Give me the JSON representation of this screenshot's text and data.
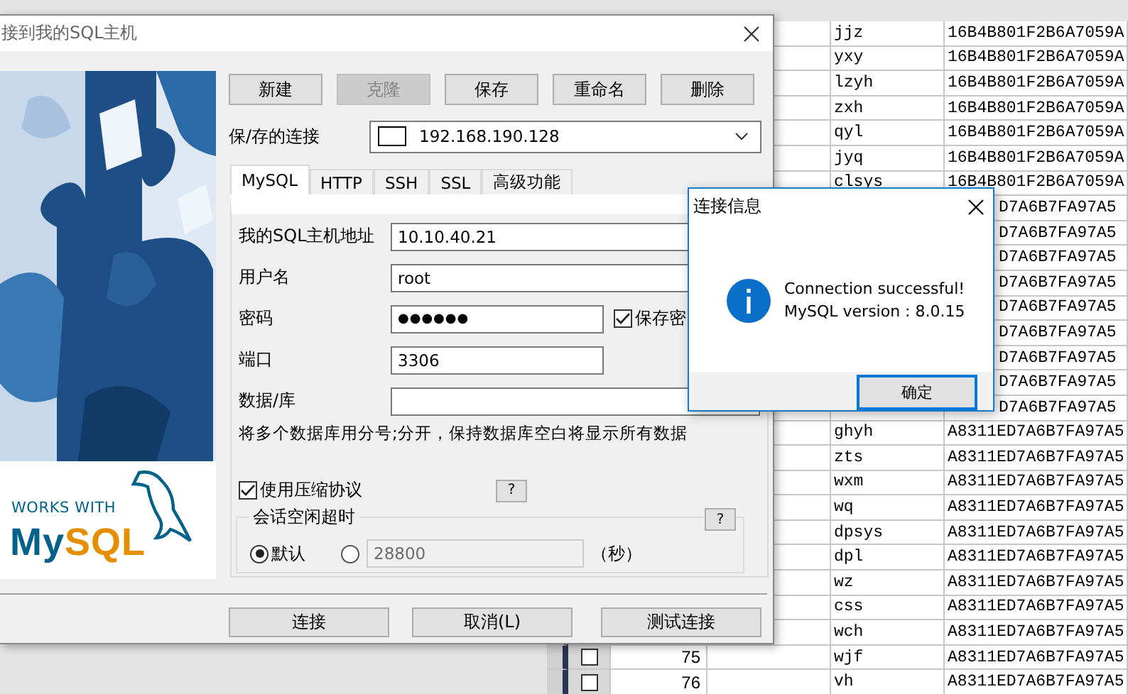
{
  "table": {
    "rows": [
      {
        "name": "jjz",
        "hash": "16B4B801F2B6A7059A"
      },
      {
        "name": "yxy",
        "hash": "16B4B801F2B6A7059A"
      },
      {
        "name": "lzyh",
        "hash": "16B4B801F2B6A7059A"
      },
      {
        "name": "zxh",
        "hash": "16B4B801F2B6A7059A"
      },
      {
        "name": "qyl",
        "hash": "16B4B801F2B6A7059A"
      },
      {
        "name": "jyq",
        "hash": "16B4B801F2B6A7059A"
      },
      {
        "name": "clsys",
        "hash": "16B4B801F2B6A7059A"
      },
      {
        "kind": "covered",
        "hash": "D7A6B7FA97A5"
      },
      {
        "kind": "covered",
        "hash": "D7A6B7FA97A5"
      },
      {
        "kind": "covered",
        "hash": "D7A6B7FA97A5"
      },
      {
        "kind": "covered",
        "hash": "D7A6B7FA97A5"
      },
      {
        "kind": "covered",
        "hash": "D7A6B7FA97A5"
      },
      {
        "kind": "covered",
        "hash": "D7A6B7FA97A5"
      },
      {
        "kind": "covered",
        "hash": "D7A6B7FA97A5"
      },
      {
        "kind": "covered",
        "hash": "D7A6B7FA97A5"
      },
      {
        "kind": "covered",
        "hash": "D7A6B7FA97A5"
      },
      {
        "name": "ghyh",
        "hash": "A8311ED7A6B7FA97A5"
      },
      {
        "name": "zts",
        "hash": "A8311ED7A6B7FA97A5"
      },
      {
        "name": "wxm",
        "hash": "A8311ED7A6B7FA97A5"
      },
      {
        "name": "wq",
        "hash": "A8311ED7A6B7FA97A5"
      },
      {
        "name": "dpsys",
        "hash": "A8311ED7A6B7FA97A5"
      },
      {
        "name": "dpl",
        "hash": "A8311ED7A6B7FA97A5"
      },
      {
        "name": "wz",
        "hash": "A8311ED7A6B7FA97A5"
      },
      {
        "name": "css",
        "hash": "A8311ED7A6B7FA97A5"
      },
      {
        "name": "wch",
        "hash": "A8311ED7A6B7FA97A5"
      },
      {
        "number": "75",
        "checked": false,
        "name": "wjf",
        "hash": "A8311ED7A6B7FA97A5"
      },
      {
        "number": "76",
        "checked": false,
        "name": "vh",
        "hash": "A8311ED7A6B7FA97A5"
      }
    ]
  },
  "main_dialog": {
    "title": "接到我的SQL主机",
    "logo": {
      "tagline": "WORKS WITH",
      "wordmark": [
        {
          "text": "My",
          "color": "#00618a"
        },
        {
          "text": "SQL",
          "color": "#e48e00"
        }
      ]
    },
    "toolbar_buttons": [
      {
        "label": "新建",
        "disabled": false
      },
      {
        "label": "克隆",
        "disabled": true
      },
      {
        "label": "保存",
        "disabled": false
      },
      {
        "label": "重命名",
        "disabled": false
      },
      {
        "label": "删除",
        "disabled": false
      }
    ],
    "saved_connection": {
      "label": "保/存的连接",
      "value": "192.168.190.128"
    },
    "tabs": [
      {
        "label": "MySQL",
        "selected": true
      },
      {
        "label": "HTTP",
        "selected": false
      },
      {
        "label": "SSH",
        "selected": false
      },
      {
        "label": "SSL",
        "selected": false
      },
      {
        "label": "高级功能",
        "selected": false
      }
    ],
    "fields": [
      {
        "label": "我的SQL主机地址",
        "kind": "text",
        "value": "10.10.40.21"
      },
      {
        "label": "用户名",
        "kind": "text",
        "value": "root"
      },
      {
        "label": "密码",
        "kind": "password",
        "value": "●●●●●●",
        "save": {
          "label": "保存密",
          "checked": true
        }
      },
      {
        "label": "端口",
        "kind": "short",
        "value": "3306"
      },
      {
        "label": "数据/库",
        "kind": "text"
      }
    ],
    "hint": "将多个数据库用分号;分开，保持数据库空白将显示所有数据",
    "compression": {
      "label": "使用压缩协议",
      "checked": true,
      "help": "?"
    },
    "idle_timeout": {
      "title": "会话空闲超时",
      "help": "?",
      "options": [
        {
          "kind": "default",
          "label": "默认",
          "selected": true
        },
        {
          "kind": "custom",
          "value": "28800",
          "selected": false
        }
      ],
      "unit": "（秒）"
    },
    "footer_buttons": [
      "连接",
      "取消(L)",
      "测试连接"
    ]
  },
  "message_box": {
    "title": "连接信息",
    "lines": [
      "Connection successful!",
      "MySQL version : 8.0.15"
    ],
    "button": "确定"
  }
}
